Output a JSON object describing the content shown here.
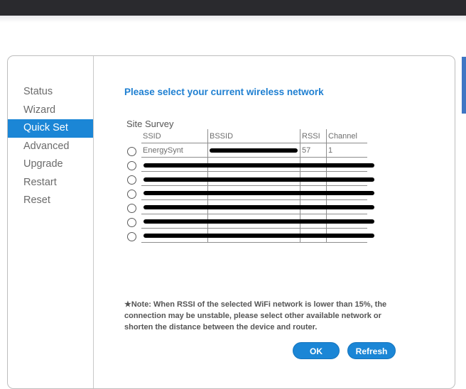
{
  "sidebar": {
    "items": [
      {
        "label": "Status"
      },
      {
        "label": "Wizard"
      },
      {
        "label": "Quick Set",
        "active": true
      },
      {
        "label": "Advanced"
      },
      {
        "label": "Upgrade"
      },
      {
        "label": "Restart"
      },
      {
        "label": "Reset"
      }
    ]
  },
  "main": {
    "title": "Please select your current wireless network",
    "site_survey_label": "Site Survey",
    "table": {
      "headers": [
        "SSID",
        "BSSID",
        "RSSI",
        "Channel"
      ],
      "rows": [
        {
          "ssid": "EnergySynt",
          "bssid": "",
          "rssi": "57",
          "channel": "1"
        },
        {
          "ssid": "",
          "bssid": "",
          "rssi": "",
          "channel": ""
        },
        {
          "ssid": "",
          "bssid": "",
          "rssi": "",
          "channel": ""
        },
        {
          "ssid": "",
          "bssid": "",
          "rssi": "",
          "channel": ""
        },
        {
          "ssid": "",
          "bssid": "",
          "rssi": "",
          "channel": ""
        },
        {
          "ssid": "",
          "bssid": "",
          "rssi": "",
          "channel": ""
        },
        {
          "ssid": "",
          "bssid": "",
          "rssi": "",
          "channel": ""
        }
      ]
    },
    "note": "★Note: When RSSI of the selected WiFi network is lower than 15%, the connection may be unstable, please select other available network or shorten the distance between the device and router.",
    "ok_label": "OK",
    "refresh_label": "Refresh"
  },
  "colors": {
    "accent": "#1b86d6",
    "title": "#1e7fd1",
    "topbar": "#2a2a2e"
  }
}
